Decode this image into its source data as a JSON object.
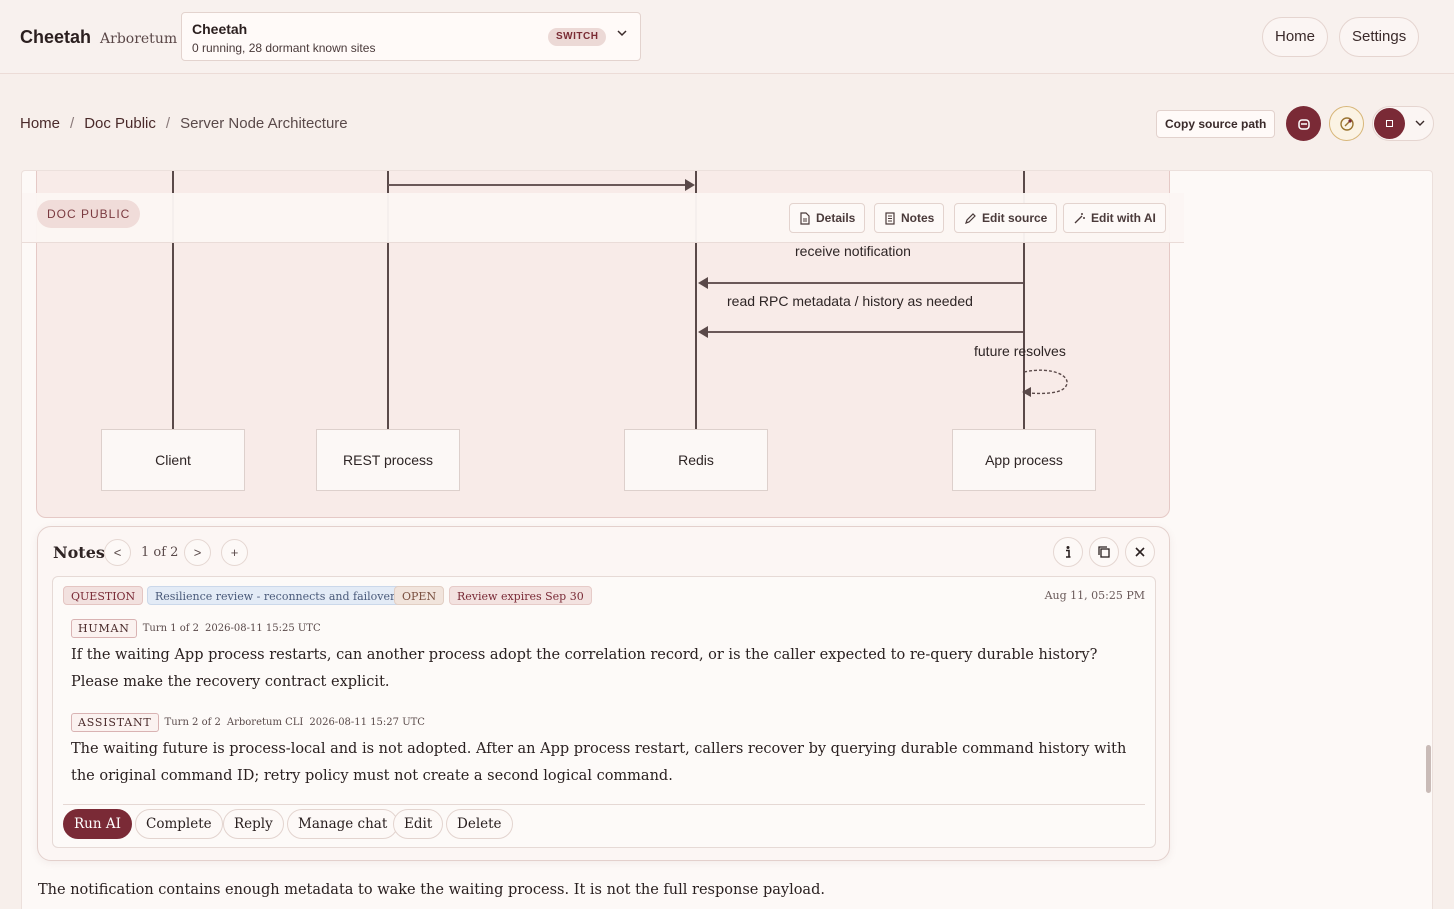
{
  "header": {
    "brand": "Cheetah",
    "brand_sub": "Arboretum",
    "site": {
      "title": "Cheetah",
      "status": "0 running, 28 dormant known sites",
      "switch_label": "SWITCH"
    },
    "nav": {
      "home": "Home",
      "settings": "Settings"
    }
  },
  "breadcrumb": {
    "home": "Home",
    "section": "Doc Public",
    "current": "Server Node Architecture",
    "sep": "/"
  },
  "page_actions": {
    "copy_source_path": "Copy source path"
  },
  "doc": {
    "badge": "DOC PUBLIC",
    "toolbar": {
      "details": "Details",
      "notes": "Notes",
      "edit_source": "Edit source",
      "edit_with_ai": "Edit with AI"
    }
  },
  "diagram": {
    "messages": [
      "receive notification",
      "read RPC metadata / history as needed",
      "future resolves"
    ],
    "actors": [
      "Client",
      "REST process",
      "Redis",
      "App process"
    ]
  },
  "notes": {
    "title": "Notes",
    "pager": {
      "prev": "<",
      "text": "1 of 2",
      "next": ">",
      "add": "+"
    },
    "note": {
      "tags": {
        "type": "QUESTION",
        "topic": "Resilience review - reconnects and failover",
        "status": "OPEN",
        "expiry": "Review expires Sep 30"
      },
      "date": "Aug 11, 05:25 PM",
      "turns": [
        {
          "role": "HUMAN",
          "meta": "Turn 1 of 2",
          "source": "",
          "time": "2026-08-11 15:25 UTC",
          "text": "If the waiting App process restarts, can another process adopt the correlation record, or is the caller expected to re-query durable history? Please make the recovery contract explicit."
        },
        {
          "role": "ASSISTANT",
          "meta": "Turn 2 of 2",
          "source": "Arboretum CLI",
          "time": "2026-08-11 15:27 UTC",
          "text": "The waiting future is process-local and is not adopted. After an App process restart, callers recover by querying durable command history with the original command ID; retry policy must not create a second logical command."
        }
      ],
      "actions": {
        "run_ai": "Run AI",
        "complete": "Complete",
        "reply": "Reply",
        "manage_chat": "Manage chat",
        "edit": "Edit",
        "delete": "Delete"
      }
    }
  },
  "body_text": "The notification contains enough metadata to wake the waiting process. It is not the full response payload.",
  "colors": {
    "accent": "#7a2a36",
    "background": "#f7efeb"
  }
}
